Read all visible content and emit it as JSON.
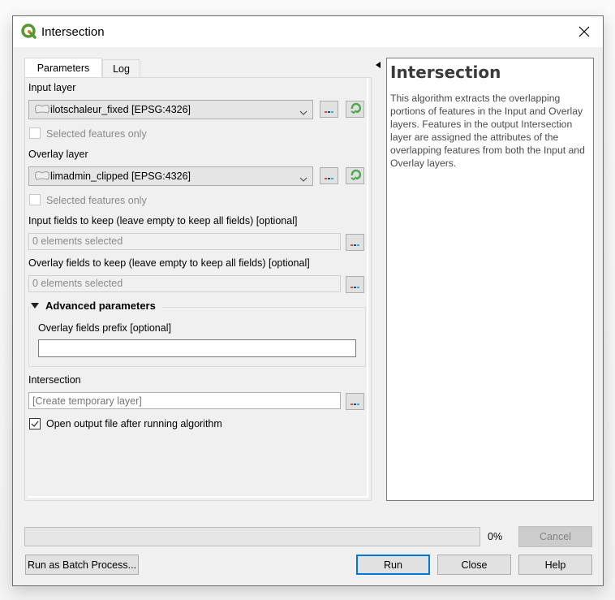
{
  "window": {
    "title": "Intersection",
    "icon": "qgis-logo-icon",
    "close_icon": "close-icon"
  },
  "tabs": [
    {
      "label": "Parameters",
      "active": true
    },
    {
      "label": "Log",
      "active": false
    }
  ],
  "params": {
    "input_layer": {
      "label": "Input layer",
      "value": "ilotschaleur_fixed [EPSG:4326]",
      "selected_only_label": "Selected features only",
      "selected_only_checked": false
    },
    "overlay_layer": {
      "label": "Overlay layer",
      "value": "limadmin_clipped [EPSG:4326]",
      "selected_only_label": "Selected features only",
      "selected_only_checked": false
    },
    "input_fields": {
      "label": "Input fields to keep (leave empty to keep all fields) [optional]",
      "value": "0 elements selected"
    },
    "overlay_fields": {
      "label": "Overlay fields to keep (leave empty to keep all fields) [optional]",
      "value": "0 elements selected"
    },
    "advanced": {
      "title": "Advanced parameters",
      "expanded": true,
      "prefix_label": "Overlay fields prefix [optional]",
      "prefix_value": ""
    },
    "output": {
      "label": "Intersection",
      "placeholder": "[Create temporary layer]",
      "open_after_label": "Open output file after running algorithm",
      "open_after_checked": true
    },
    "ellipsis_label": "…"
  },
  "help": {
    "title": "Intersection",
    "text": "This algorithm extracts the overlapping portions of features in the Input and Overlay layers. Features in the output Intersection layer are assigned the attributes of the overlapping features from both the Input and Overlay layers."
  },
  "progress": {
    "value": 0,
    "label": "0%"
  },
  "buttons": {
    "cancel": "Cancel",
    "batch": "Run as Batch Process...",
    "run": "Run",
    "close": "Close",
    "help": "Help"
  },
  "colors": {
    "accent": "#0078d7",
    "refresh_green": "#5cb85c"
  }
}
